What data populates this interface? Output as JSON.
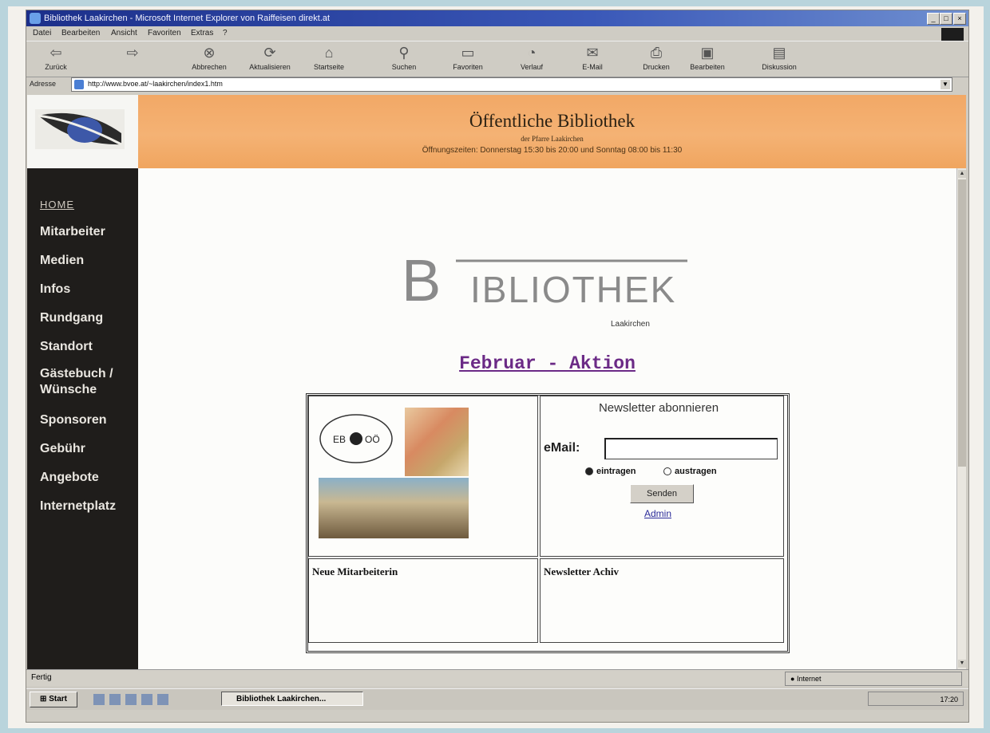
{
  "window": {
    "title": "Bibliothek Laakirchen - Microsoft Internet Explorer von Raiffeisen direkt.at"
  },
  "menu": [
    "Datei",
    "Bearbeiten",
    "Ansicht",
    "Favoriten",
    "Extras",
    "?"
  ],
  "toolbar": {
    "back": "Zurück",
    "stop": "Abbrechen",
    "refresh": "Aktualisieren",
    "home": "Startseite",
    "search": "Suchen",
    "favorites": "Favoriten",
    "history": "Verlauf",
    "mail": "E-Mail",
    "print": "Drucken",
    "edit": "Bearbeiten",
    "discuss": "Diskussion"
  },
  "address": {
    "label": "Adresse",
    "url": "http://www.bvoe.at/~laakirchen/index1.htm"
  },
  "header": {
    "title": "Öffentliche Bibliothek",
    "subtitle": "der Pfarre Laakirchen",
    "hours": "Öffnungszeiten: Donnerstag 15:30 bis 20:00 und Sonntag 08:00 bis 11:30"
  },
  "sidebar": {
    "items": [
      "HOME",
      "Mitarbeiter",
      "Medien",
      "Infos",
      "Rundgang",
      "Standort",
      "Gästebuch / Wünsche",
      "Sponsoren",
      "Gebühr",
      "Angebote",
      "Internetplatz"
    ]
  },
  "main": {
    "logo_text": "BIBLIOTHEK",
    "logo_sub": "Laakirchen",
    "aktion_link": "Februar - Aktion",
    "newsletter": {
      "title": "Newsletter abonnieren",
      "email_label": "eMail:",
      "email_value": "",
      "radio_subscribe": "eintragen",
      "radio_unsubscribe": "austragen",
      "send_button": "Senden",
      "admin_link": "Admin"
    },
    "cell_new_staff": "Neue Mitarbeiterin",
    "cell_archive": "Newsletter Achiv"
  },
  "status": {
    "text": "Fertig",
    "zone": "Internet"
  },
  "taskbar": {
    "start": "Start",
    "task": "Bibliothek Laakirchen...",
    "clock": "17:20"
  },
  "colors": {
    "banner": "#f2a866",
    "sidebar": "#1f1d1b",
    "link": "#6b2a86",
    "titlebar": "#1c2f8a"
  }
}
